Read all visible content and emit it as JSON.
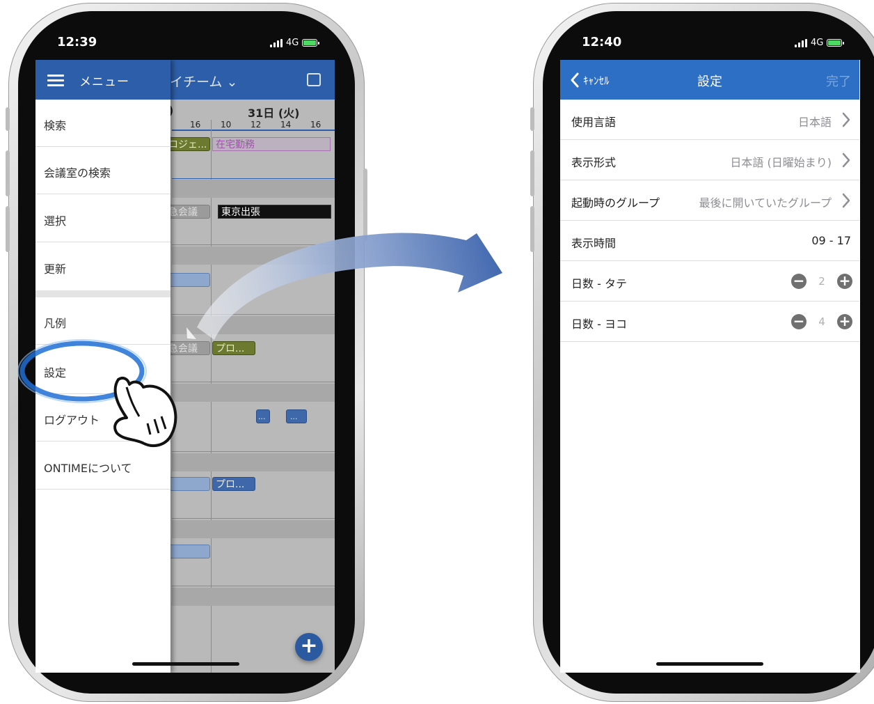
{
  "left_phone": {
    "status": {
      "time": "12:39",
      "network": "4G"
    },
    "calendar": {
      "header_title": "イチーム ⌄",
      "date_partial": ")",
      "date_label": "31日 (火)",
      "hours_left": [
        "16"
      ],
      "hours_right": [
        "10",
        "12",
        "14",
        "16"
      ],
      "events": {
        "ev1": "ロジェ...",
        "ev2": "在宅勤務",
        "ev3": "急会議",
        "ev4": "東京出張",
        "ev5": "急会議",
        "ev6": "プロ...",
        "ev7": "...",
        "ev8": "...",
        "ev9": "プロ..."
      },
      "fab": "+"
    },
    "drawer": {
      "title": "メニュー",
      "items": [
        "検索",
        "会議室の検索",
        "選択",
        "更新",
        "凡例",
        "設定",
        "ログアウト",
        "ONTIMEについて"
      ]
    }
  },
  "right_phone": {
    "status": {
      "time": "12:40",
      "network": "4G"
    },
    "nav": {
      "cancel": "ｷｬﾝｾﾙ",
      "title": "設定",
      "done": "完了"
    },
    "rows": [
      {
        "label": "使用言語",
        "value": "日本語"
      },
      {
        "label": "表示形式",
        "value": "日本語 (日曜始まり)"
      },
      {
        "label": "起動時のグループ",
        "value": "最後に開いていたグループ"
      },
      {
        "label": "表示時間",
        "value": "09 - 17"
      },
      {
        "label": "日数 - タテ",
        "value": "2"
      },
      {
        "label": "日数 - ヨコ",
        "value": "4"
      }
    ]
  },
  "colors": {
    "header_blue": "#2d5ea9",
    "nav_blue": "#2d6fc4",
    "highlight_blue": "#1f6fd6",
    "arrow_blue": "#3f66ae"
  },
  "icons": [
    "hamburger-icon",
    "calendar-icon",
    "plus-icon",
    "chevron-left-icon",
    "chevron-right-icon",
    "minus-circle-icon",
    "plus-circle-icon",
    "pointing-hand-icon",
    "curved-arrow-icon"
  ]
}
